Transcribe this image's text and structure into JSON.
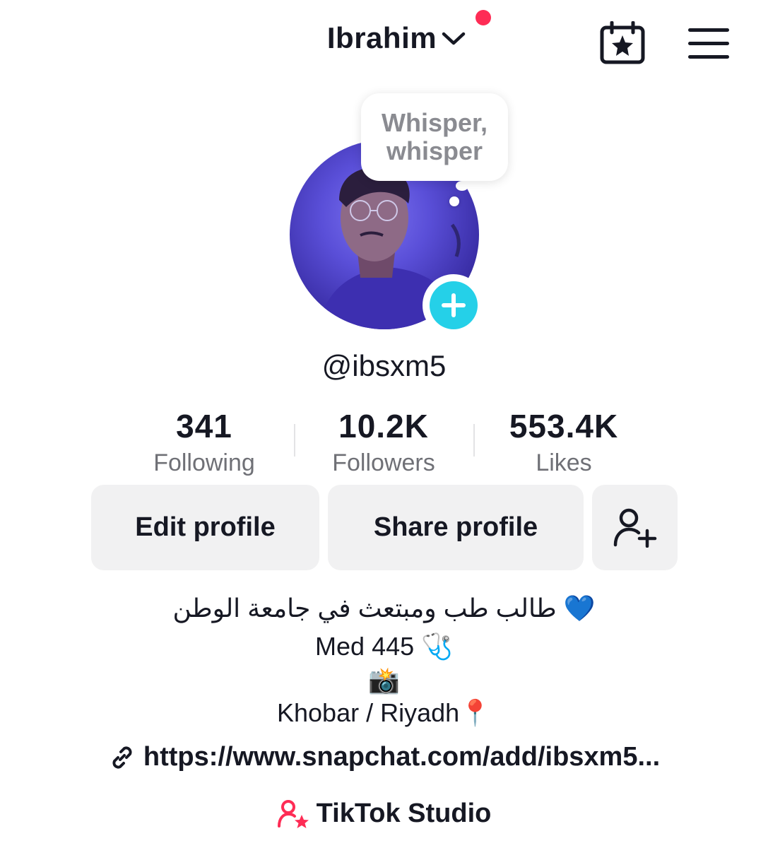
{
  "header": {
    "username": "Ibrahim",
    "notification_color": "#fe2c55",
    "calendar_icon": "calendar-star-icon",
    "menu_icon": "hamburger-menu-icon"
  },
  "profile": {
    "note_bubble": "Whisper, whisper",
    "handle": "@ibsxm5",
    "add_avatar_color": "#25d0e8"
  },
  "stats": [
    {
      "value": "341",
      "label": "Following"
    },
    {
      "value": "10.2K",
      "label": "Followers"
    },
    {
      "value": "553.4K",
      "label": "Likes"
    }
  ],
  "actions": {
    "edit_label": "Edit profile",
    "share_label": "Share profile",
    "add_friend_icon": "add-friend-icon"
  },
  "bio": {
    "line1": "طالب طب ومبتعث في جامعة الوطن 💙",
    "line2": "Med 445 🩺",
    "line3": "📸",
    "line4": "Khobar / Riyadh📍"
  },
  "link": {
    "icon": "link-icon",
    "text": "https://www.snapchat.com/add/ibsxm5..."
  },
  "studio": {
    "icon": "tiktok-studio-icon",
    "label": "TikTok Studio",
    "icon_color": "#fe2c55"
  }
}
